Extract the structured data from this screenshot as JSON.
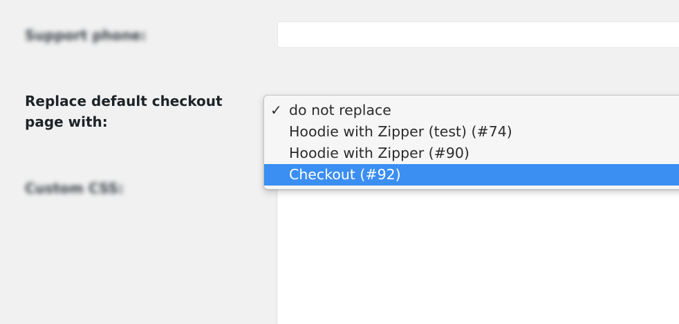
{
  "form": {
    "support_phone_label": "Support phone:",
    "support_phone_value": "",
    "replace_label": "Replace default checkout page with:",
    "custom_css_label": "Custom CSS:",
    "custom_css_value": ""
  },
  "dropdown": {
    "selected_index": 0,
    "highlighted_index": 3,
    "checkmark_icon": "checkmark-icon",
    "highlight_color": "#3b8ef2",
    "options": [
      {
        "label": "do not replace"
      },
      {
        "label": "Hoodie with Zipper (test) (#74)"
      },
      {
        "label": "Hoodie with Zipper (#90)"
      },
      {
        "label": "Checkout (#92)"
      }
    ]
  }
}
